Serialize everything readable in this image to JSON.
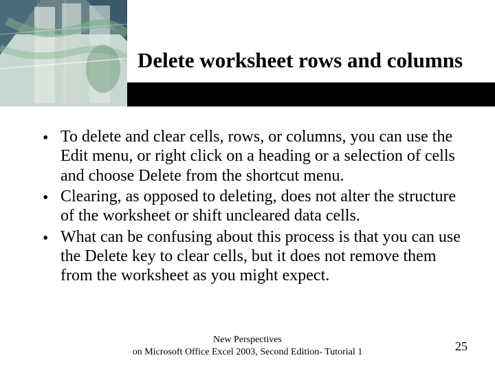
{
  "header": {
    "title": "Delete worksheet rows and columns"
  },
  "content": {
    "bullets": [
      "To delete and clear cells, rows, or columns, you can use the Edit menu, or right click on a heading or a selection of cells and choose Delete from the shortcut menu.",
      "Clearing, as opposed to deleting, does not alter the structure of the worksheet or shift uncleared data cells.",
      "What can be confusing about this process is that you can use the Delete key to clear cells, but it does not remove them from the worksheet as you might expect."
    ]
  },
  "footer": {
    "center_line1": "New Perspectives",
    "center_line2": "on Microsoft Office Excel 2003, Second Edition- Tutorial 1",
    "page_number": "25"
  }
}
